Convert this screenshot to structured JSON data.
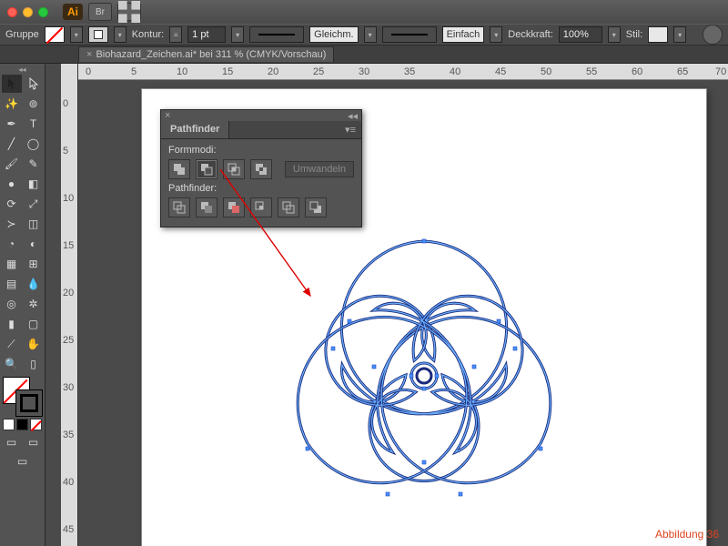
{
  "app": {
    "badge_text": "Ai"
  },
  "controlbar": {
    "group_label": "Gruppe",
    "kontur_label": "Kontur:",
    "stroke_weight": "1 pt",
    "dash_label": "Gleichm.",
    "profile_label": "Einfach",
    "deckkraft_label": "Deckkraft:",
    "opacity_value": "100%",
    "stil_label": "Stil:"
  },
  "doc": {
    "tab_title": "Biohazard_Zeichen.ai* bei 311 % (CMYK/Vorschau)",
    "close_glyph": "×"
  },
  "ruler": {
    "h": [
      "0",
      "5",
      "10",
      "15",
      "20",
      "25",
      "30",
      "35",
      "40",
      "45",
      "50",
      "55",
      "60",
      "65",
      "70"
    ],
    "v": [
      "0",
      "5",
      "10",
      "15",
      "20",
      "25",
      "30",
      "35",
      "40",
      "45"
    ]
  },
  "pathfinder": {
    "title": "Pathfinder",
    "formmodi_label": "Formmodi:",
    "pathfinder_label": "Pathfinder:",
    "umwandeln_label": "Umwandeln",
    "close_glyph": "×",
    "collapse_glyph": "◂◂"
  },
  "caption": "Abbildung 36"
}
